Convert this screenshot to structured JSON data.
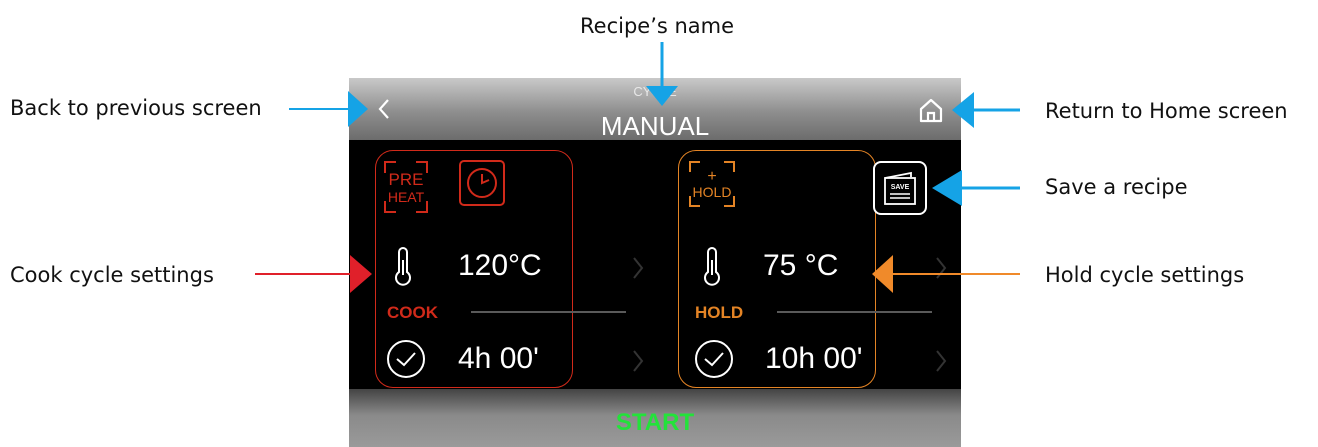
{
  "callouts": {
    "recipe_name": "Recipe’s name",
    "back": "Back to previous screen",
    "home": "Return to Home screen",
    "save": "Save a recipe",
    "cook": "Cook cycle settings",
    "hold": "Hold cycle settings"
  },
  "screen": {
    "subtitle": "CYCLE",
    "title": "MANUAL",
    "cook": {
      "preheat_top": "PRE",
      "preheat_bottom": "HEAT",
      "temperature": "120°C",
      "label": "COOK",
      "time": "4h 00'"
    },
    "hold": {
      "hold_plus": "+",
      "hold_label": "HOLD",
      "temperature": "75 °C",
      "label": "HOLD",
      "time": "10h 00'"
    },
    "save_label": "SAVE",
    "start_label": "START"
  },
  "colors": {
    "cook_accent": "#d12a1a",
    "hold_accent": "#e48425",
    "start_green": "#23e23a",
    "arrow_blue": "#15a3e6",
    "arrow_red": "#e0202a",
    "arrow_orange": "#f08a2a"
  }
}
